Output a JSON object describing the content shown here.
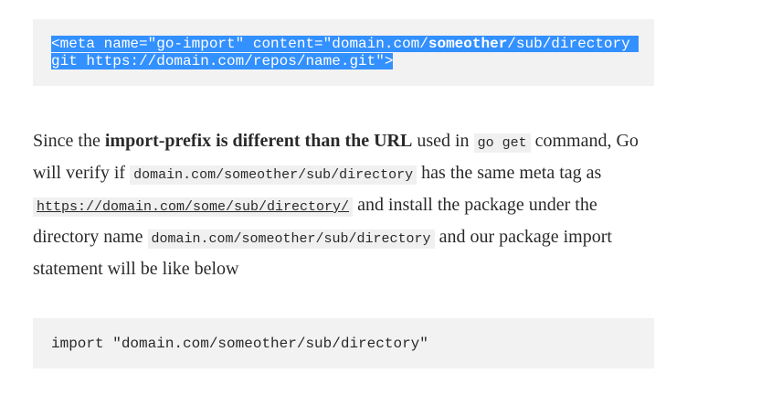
{
  "code_block_1": {
    "line1_part1": "<meta name=\"go-import\" content=\"domain.com/",
    "line1_bold": "someother",
    "line1_part2": "/sub/directory ",
    "line2": "git https://domain.com/repos/name.git\">"
  },
  "paragraph": {
    "t1": "Since the ",
    "bold1": "import-prefix is different than the URL",
    "t2": " used in ",
    "code1": "go get",
    "t3": " command, Go will verify if ",
    "code2": "domain.com/someother/sub/directory",
    "t4": " has the same meta tag as ",
    "link1": "https://domain.com/some/sub/directory/",
    "t5": " and install the package under the directory name ",
    "code3": "domain.com/someother/sub/directory",
    "t6": " and our package import statement will be like below"
  },
  "code_block_2": {
    "line1": "import \"domain.com/someother/sub/directory\""
  },
  "colors": {
    "selection": "#3390ff",
    "code_background": "#f2f2f2",
    "text": "#292929"
  }
}
